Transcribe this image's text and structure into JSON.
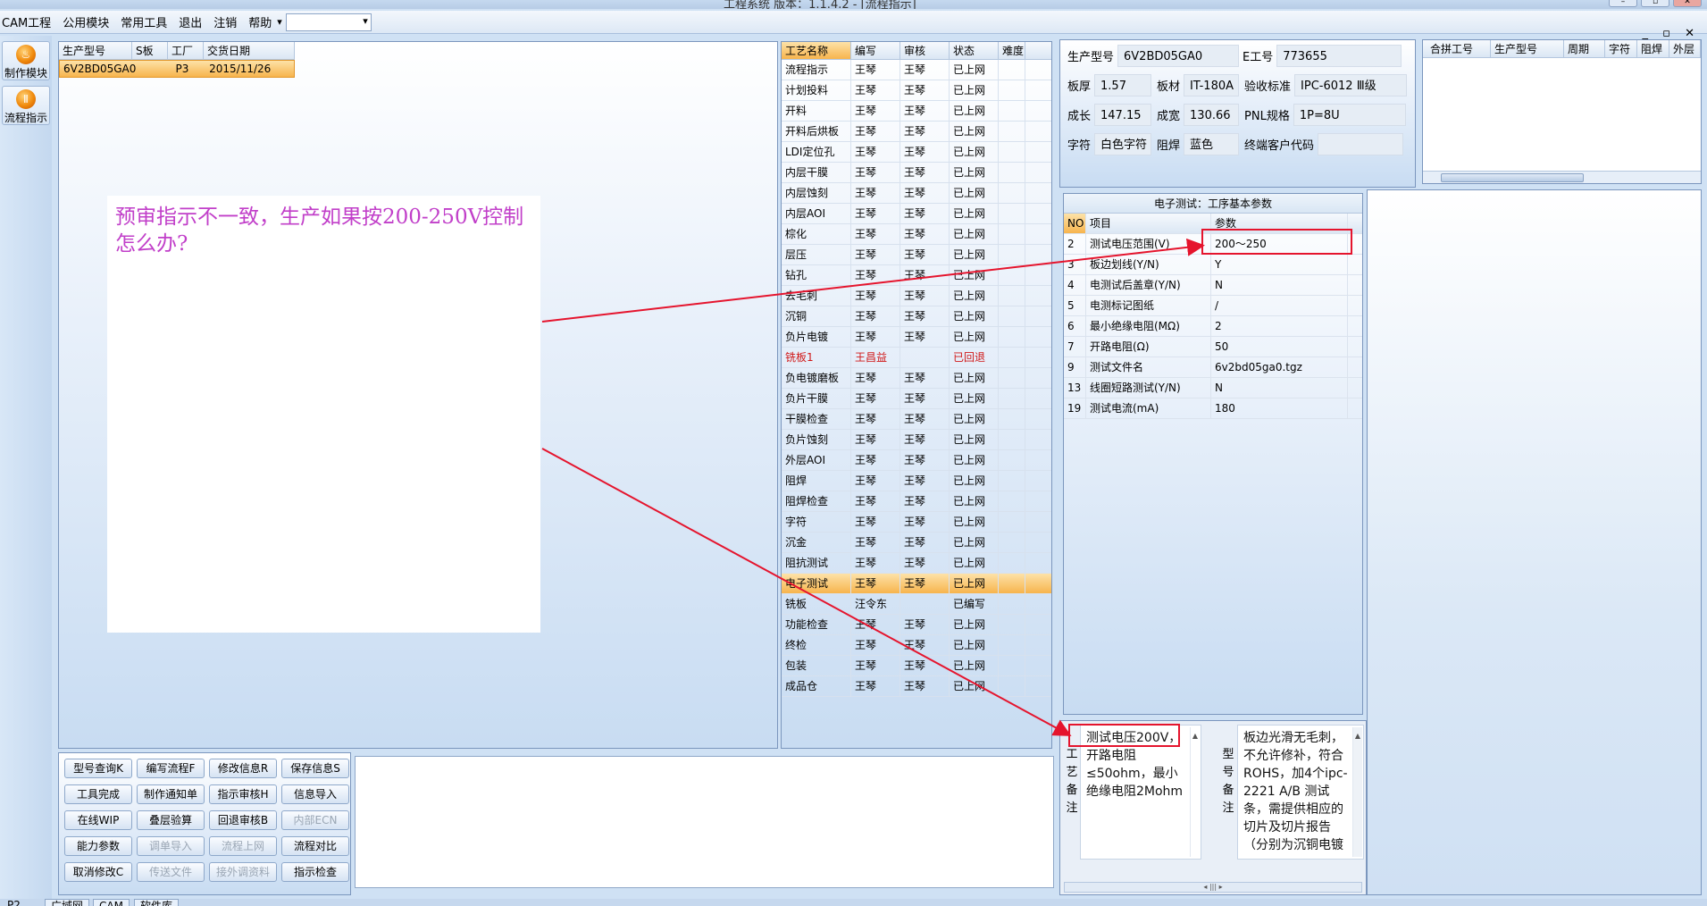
{
  "window": {
    "title": "工程系统   版本：1.1.4.2 - [流程指示]"
  },
  "menu": {
    "items": [
      "CAM工程",
      "公用模块",
      "常用工具",
      "退出",
      "注销",
      "帮助"
    ],
    "help_arrow": "▾"
  },
  "rail": {
    "buttons": [
      {
        "label": "制作模块",
        "icon": "fire-icon"
      },
      {
        "label": "流程指示",
        "icon": "pause-icon"
      }
    ]
  },
  "list": {
    "columns": [
      "生产型号",
      "S板",
      "工厂",
      "交货日期"
    ],
    "rows": [
      {
        "model": "6V2BD05GA0",
        "sboard": "",
        "factory": "P3",
        "date": "2015/11/26"
      }
    ]
  },
  "note": {
    "text": "预审指示不一致，生产如果按200-250V控制怎么办?"
  },
  "process": {
    "columns": [
      "工艺名称",
      "编写",
      "审核",
      "状态",
      "难度"
    ],
    "rows": [
      {
        "name": "流程指示",
        "writer": "王琴",
        "reviewer": "王琴",
        "status": "已上网"
      },
      {
        "name": "计划投料",
        "writer": "王琴",
        "reviewer": "王琴",
        "status": "已上网"
      },
      {
        "name": "开料",
        "writer": "王琴",
        "reviewer": "王琴",
        "status": "已上网"
      },
      {
        "name": "开料后烘板",
        "writer": "王琴",
        "reviewer": "王琴",
        "status": "已上网"
      },
      {
        "name": "LDI定位孔",
        "writer": "王琴",
        "reviewer": "王琴",
        "status": "已上网"
      },
      {
        "name": "内层干膜",
        "writer": "王琴",
        "reviewer": "王琴",
        "status": "已上网"
      },
      {
        "name": "内层蚀刻",
        "writer": "王琴",
        "reviewer": "王琴",
        "status": "已上网"
      },
      {
        "name": "内层AOI",
        "writer": "王琴",
        "reviewer": "王琴",
        "status": "已上网"
      },
      {
        "name": "棕化",
        "writer": "王琴",
        "reviewer": "王琴",
        "status": "已上网"
      },
      {
        "name": "层压",
        "writer": "王琴",
        "reviewer": "王琴",
        "status": "已上网"
      },
      {
        "name": "钻孔",
        "writer": "王琴",
        "reviewer": "王琴",
        "status": "已上网"
      },
      {
        "name": "去毛刺",
        "writer": "王琴",
        "reviewer": "王琴",
        "status": "已上网"
      },
      {
        "name": "沉铜",
        "writer": "王琴",
        "reviewer": "王琴",
        "status": "已上网"
      },
      {
        "name": "负片电镀",
        "writer": "王琴",
        "reviewer": "王琴",
        "status": "已上网"
      },
      {
        "name": "铣板1",
        "writer": "王昌益",
        "reviewer": "",
        "status": "已回退",
        "red": true
      },
      {
        "name": "负电镀磨板",
        "writer": "王琴",
        "reviewer": "王琴",
        "status": "已上网"
      },
      {
        "name": "负片干膜",
        "writer": "王琴",
        "reviewer": "王琴",
        "status": "已上网"
      },
      {
        "name": "干膜检查",
        "writer": "王琴",
        "reviewer": "王琴",
        "status": "已上网"
      },
      {
        "name": "负片蚀刻",
        "writer": "王琴",
        "reviewer": "王琴",
        "status": "已上网"
      },
      {
        "name": "外层AOI",
        "writer": "王琴",
        "reviewer": "王琴",
        "status": "已上网"
      },
      {
        "name": "阻焊",
        "writer": "王琴",
        "reviewer": "王琴",
        "status": "已上网"
      },
      {
        "name": "阻焊检查",
        "writer": "王琴",
        "reviewer": "王琴",
        "status": "已上网"
      },
      {
        "name": "字符",
        "writer": "王琴",
        "reviewer": "王琴",
        "status": "已上网"
      },
      {
        "name": "沉金",
        "writer": "王琴",
        "reviewer": "王琴",
        "status": "已上网"
      },
      {
        "name": "阻抗测试",
        "writer": "王琴",
        "reviewer": "王琴",
        "status": "已上网"
      },
      {
        "name": "电子测试",
        "writer": "王琴",
        "reviewer": "王琴",
        "status": "已上网",
        "selected": true
      },
      {
        "name": "铣板",
        "writer": "汪令东",
        "reviewer": "",
        "status": "已编写"
      },
      {
        "name": "功能检查",
        "writer": "王琴",
        "reviewer": "王琴",
        "status": "已上网"
      },
      {
        "name": "终检",
        "writer": "王琴",
        "reviewer": "王琴",
        "status": "已上网"
      },
      {
        "name": "包装",
        "writer": "王琴",
        "reviewer": "王琴",
        "status": "已上网"
      },
      {
        "name": "成品仓",
        "writer": "王琴",
        "reviewer": "王琴",
        "status": "已上网"
      }
    ]
  },
  "info": {
    "model_label": "生产型号",
    "model": "6V2BD05GA0",
    "eno_label": "E工号",
    "eno": "773655",
    "thick_label": "板厚",
    "thick": "1.57",
    "material_label": "板材",
    "material": "IT-180A",
    "std_label": "验收标准",
    "std": "IPC-6012 Ⅲ级",
    "len_label": "成长",
    "len": "147.15",
    "wid_label": "成宽",
    "wid": "130.66",
    "pnl_label": "PNL规格",
    "pnl": "1P=8U",
    "char_label": "字符",
    "char": "白色字符",
    "mask_label": "阻焊",
    "mask": "蓝色",
    "cust_label": "终端客户代码",
    "cust": ""
  },
  "merge": {
    "columns": [
      "合拼工号",
      "生产型号",
      "周期",
      "字符",
      "阻焊",
      "外层"
    ]
  },
  "params": {
    "title": "电子测试：工序基本参数",
    "columns": [
      "NO",
      "项目",
      "参数"
    ],
    "rows": [
      {
        "no": "2",
        "item": "测试电压范围(V)",
        "value": "200～250"
      },
      {
        "no": "3",
        "item": "板边划线(Y/N)",
        "value": "Y"
      },
      {
        "no": "4",
        "item": "电测试后盖章(Y/N)",
        "value": "N"
      },
      {
        "no": "5",
        "item": "电测标记图纸",
        "value": "/"
      },
      {
        "no": "6",
        "item": "最小绝缘电阻(MΩ)",
        "value": "2"
      },
      {
        "no": "7",
        "item": "开路电阻(Ω)",
        "value": "50"
      },
      {
        "no": "9",
        "item": "测试文件名",
        "value": "6v2bd05ga0.tgz"
      },
      {
        "no": "13",
        "item": "线圈短路测试(Y/N)",
        "value": "N"
      },
      {
        "no": "19",
        "item": "测试电流(mA)",
        "value": "180"
      }
    ]
  },
  "remarks": {
    "process_label": "工艺备注",
    "process_text": "测试电压200V，开路电阻≤50ohm，最小绝缘电阻2Mohm",
    "model_label": "型号备注",
    "model_text": "板边光滑无毛刺，不允许修补，符合ROHS，加4个ipc-2221 A/B 测试条，需提供相应的切片及切片报告（分别为沉铜电镀"
  },
  "buttons": [
    {
      "label": "型号查询K",
      "enabled": true
    },
    {
      "label": "编写流程F",
      "enabled": true
    },
    {
      "label": "修改信息R",
      "enabled": true
    },
    {
      "label": "保存信息S",
      "enabled": true
    },
    {
      "label": "工具完成",
      "enabled": true
    },
    {
      "label": "制作通知单",
      "enabled": true
    },
    {
      "label": "指示审核H",
      "enabled": true
    },
    {
      "label": "信息导入",
      "enabled": true
    },
    {
      "label": "在线WIP",
      "enabled": true
    },
    {
      "label": "叠层验算",
      "enabled": true
    },
    {
      "label": "回退审核B",
      "enabled": true
    },
    {
      "label": "内部ECN",
      "enabled": false
    },
    {
      "label": "能力参数",
      "enabled": true
    },
    {
      "label": "调单导入",
      "enabled": false
    },
    {
      "label": "流程上网",
      "enabled": false
    },
    {
      "label": "流程对比",
      "enabled": true
    },
    {
      "label": "取消修改C",
      "enabled": true
    },
    {
      "label": "传送文件",
      "enabled": false
    },
    {
      "label": "接外调资料",
      "enabled": false
    },
    {
      "label": "指示检查",
      "enabled": true
    }
  ],
  "tabs": [
    "P2",
    "广域网",
    "CAM",
    "软件库"
  ],
  "colors": {
    "annotation": "#e5142d",
    "note_text": "#c13fc9",
    "selection": "#f7b44d"
  }
}
